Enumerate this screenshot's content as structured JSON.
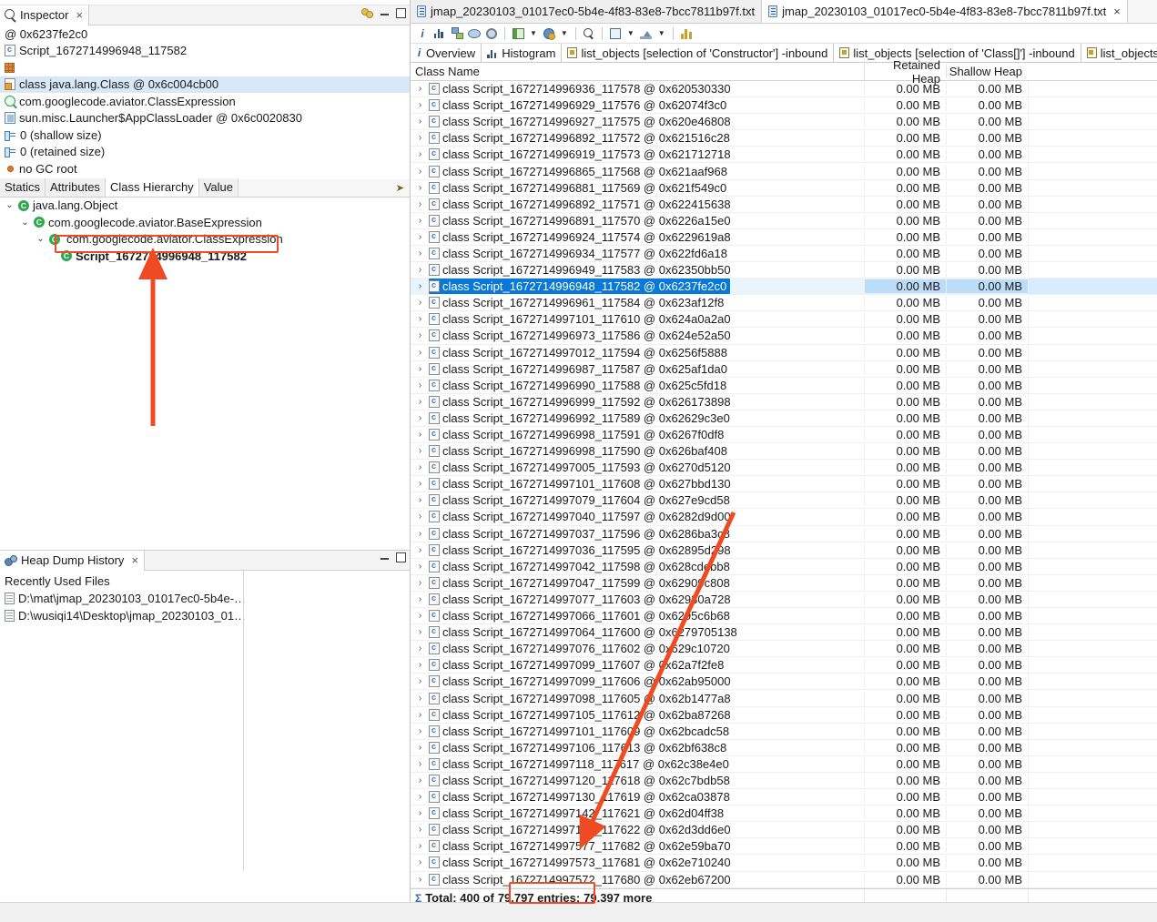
{
  "window": {
    "accent_color": "#0a78d7",
    "annotation_color": "#f04a22"
  },
  "inspector": {
    "tab_label": "Inspector",
    "tab_close": "×",
    "rows": [
      {
        "icon": "at-icon",
        "text": "@ 0x6237fe2c0"
      },
      {
        "icon": "class-file-icon",
        "text": "Script_1672714996948_117582"
      },
      {
        "icon": "grid-icon",
        "text": ""
      },
      {
        "icon": "java-class-icon",
        "text": "class java.lang.Class @ 0x6c004cb00",
        "highlighted": true
      },
      {
        "icon": "magnifier-icon",
        "text": "com.googlecode.aviator.ClassExpression"
      },
      {
        "icon": "classloader-icon",
        "text": "sun.misc.Launcher$AppClassLoader @ 0x6c0020830"
      },
      {
        "icon": "size-icon",
        "text": "0 (shallow size)"
      },
      {
        "icon": "size-icon",
        "text": "0 (retained size)"
      },
      {
        "icon": "gc-root-icon",
        "text": "no GC root"
      }
    ],
    "subtabs": [
      {
        "label": "Statics",
        "active": false
      },
      {
        "label": "Attributes",
        "active": false
      },
      {
        "label": "Class Hierarchy",
        "active": true
      },
      {
        "label": "Value",
        "active": false
      }
    ],
    "hierarchy": [
      {
        "indent": 0,
        "twisty": "⌄",
        "label": "java.lang.Object",
        "bold": false
      },
      {
        "indent": 1,
        "twisty": "⌄",
        "label": "com.googlecode.aviator.BaseExpression",
        "bold": false
      },
      {
        "indent": 2,
        "twisty": "⌄",
        "label": "com.googlecode.aviator.ClassExpression",
        "bold": false,
        "boxed": true
      },
      {
        "indent": 3,
        "twisty": "",
        "label": "Script_1672714996948_117582",
        "bold": true
      }
    ]
  },
  "heap_dump_history": {
    "tab_label": "Heap Dump History",
    "tab_close": "×",
    "section_label": "Recently Used Files",
    "files": [
      "D:\\mat\\jmap_20230103_01017ec0-5b4e-…",
      "D:\\wusiqi14\\Desktop\\jmap_20230103_01…"
    ]
  },
  "editor": {
    "tabs": [
      {
        "label": "jmap_20230103_01017ec0-5b4e-4f83-83e8-7bcc7811b97f.txt",
        "active": false,
        "closable": false
      },
      {
        "label": "jmap_20230103_01017ec0-5b4e-4f83-83e8-7bcc7811b97f.txt",
        "active": true,
        "closable": true
      }
    ],
    "tab_close": "×",
    "toolbar": [
      {
        "name": "info-icon"
      },
      {
        "name": "histogram-icon"
      },
      {
        "name": "dominator-tree-icon"
      },
      {
        "name": "inspect-icon"
      },
      {
        "name": "gear-icon"
      },
      {
        "name": "separator"
      },
      {
        "name": "group-by-icon"
      },
      {
        "name": "caret-down-icon"
      },
      {
        "name": "calculate-icon"
      },
      {
        "name": "caret-down-icon"
      },
      {
        "name": "separator"
      },
      {
        "name": "search-icon"
      },
      {
        "name": "separator"
      },
      {
        "name": "table-icon"
      },
      {
        "name": "caret-down-icon"
      },
      {
        "name": "export-icon"
      },
      {
        "name": "caret-down-icon"
      },
      {
        "name": "separator"
      },
      {
        "name": "chart-icon"
      }
    ],
    "result_tabs": [
      {
        "icon": "info-icon",
        "label": "Overview"
      },
      {
        "icon": "histogram-icon",
        "label": "Histogram"
      },
      {
        "icon": "query-icon",
        "label": "list_objects  [selection of 'Constructor'] -inbound"
      },
      {
        "icon": "query-icon",
        "label": "list_objects  [selection of 'Class[]'] -inbound"
      },
      {
        "icon": "query-icon",
        "label": "list_objects  [se"
      }
    ]
  },
  "table": {
    "columns": [
      "Class Name",
      "Retained Heap",
      "Shallow Heap"
    ],
    "twisty": "›",
    "rows": [
      {
        "name": "class Script_1672714996936_117578 @ 0x620530330",
        "retained": "0.00 MB",
        "shallow": "0.00 MB"
      },
      {
        "name": "class Script_1672714996929_117576 @ 0x62074f3c0",
        "retained": "0.00 MB",
        "shallow": "0.00 MB"
      },
      {
        "name": "class Script_1672714996927_117575 @ 0x620e46808",
        "retained": "0.00 MB",
        "shallow": "0.00 MB"
      },
      {
        "name": "class Script_1672714996892_117572 @ 0x621516c28",
        "retained": "0.00 MB",
        "shallow": "0.00 MB"
      },
      {
        "name": "class Script_1672714996919_117573 @ 0x621712718",
        "retained": "0.00 MB",
        "shallow": "0.00 MB"
      },
      {
        "name": "class Script_1672714996865_117568 @ 0x621aaf968",
        "retained": "0.00 MB",
        "shallow": "0.00 MB"
      },
      {
        "name": "class Script_1672714996881_117569 @ 0x621f549c0",
        "retained": "0.00 MB",
        "shallow": "0.00 MB"
      },
      {
        "name": "class Script_1672714996892_117571 @ 0x622415638",
        "retained": "0.00 MB",
        "shallow": "0.00 MB"
      },
      {
        "name": "class Script_1672714996891_117570 @ 0x6226a15e0",
        "retained": "0.00 MB",
        "shallow": "0.00 MB"
      },
      {
        "name": "class Script_1672714996924_117574 @ 0x6229619a8",
        "retained": "0.00 MB",
        "shallow": "0.00 MB"
      },
      {
        "name": "class Script_1672714996934_117577 @ 0x622fd6a18",
        "retained": "0.00 MB",
        "shallow": "0.00 MB"
      },
      {
        "name": "class Script_1672714996949_117583 @ 0x62350bb50",
        "retained": "0.00 MB",
        "shallow": "0.00 MB"
      },
      {
        "name": "class Script_1672714996948_117582 @ 0x6237fe2c0",
        "retained": "0.00 MB",
        "shallow": "0.00 MB",
        "selected": true
      },
      {
        "name": "class Script_1672714996961_117584 @ 0x623af12f8",
        "retained": "0.00 MB",
        "shallow": "0.00 MB"
      },
      {
        "name": "class Script_1672714997101_117610 @ 0x624a0a2a0",
        "retained": "0.00 MB",
        "shallow": "0.00 MB"
      },
      {
        "name": "class Script_1672714996973_117586 @ 0x624e52a50",
        "retained": "0.00 MB",
        "shallow": "0.00 MB"
      },
      {
        "name": "class Script_1672714997012_117594 @ 0x6256f5888",
        "retained": "0.00 MB",
        "shallow": "0.00 MB"
      },
      {
        "name": "class Script_1672714996987_117587 @ 0x625af1da0",
        "retained": "0.00 MB",
        "shallow": "0.00 MB"
      },
      {
        "name": "class Script_1672714996990_117588 @ 0x625c5fd18",
        "retained": "0.00 MB",
        "shallow": "0.00 MB"
      },
      {
        "name": "class Script_1672714996999_117592 @ 0x626173898",
        "retained": "0.00 MB",
        "shallow": "0.00 MB"
      },
      {
        "name": "class Script_1672714996992_117589 @ 0x62629c3e0",
        "retained": "0.00 MB",
        "shallow": "0.00 MB"
      },
      {
        "name": "class Script_1672714996998_117591 @ 0x6267f0df8",
        "retained": "0.00 MB",
        "shallow": "0.00 MB"
      },
      {
        "name": "class Script_1672714996998_117590 @ 0x626baf408",
        "retained": "0.00 MB",
        "shallow": "0.00 MB"
      },
      {
        "name": "class Script_1672714997005_117593 @ 0x6270d5120",
        "retained": "0.00 MB",
        "shallow": "0.00 MB"
      },
      {
        "name": "class Script_1672714997101_117608 @ 0x627bbd130",
        "retained": "0.00 MB",
        "shallow": "0.00 MB"
      },
      {
        "name": "class Script_1672714997079_117604 @ 0x627e9cd58",
        "retained": "0.00 MB",
        "shallow": "0.00 MB"
      },
      {
        "name": "class Script_1672714997040_117597 @ 0x6282d9d00",
        "retained": "0.00 MB",
        "shallow": "0.00 MB"
      },
      {
        "name": "class Script_1672714997037_117596 @ 0x6286ba3c8",
        "retained": "0.00 MB",
        "shallow": "0.00 MB"
      },
      {
        "name": "class Script_1672714997036_117595 @ 0x62895d298",
        "retained": "0.00 MB",
        "shallow": "0.00 MB"
      },
      {
        "name": "class Script_1672714997042_117598 @ 0x628cdebb8",
        "retained": "0.00 MB",
        "shallow": "0.00 MB"
      },
      {
        "name": "class Script_1672714997047_117599 @ 0x62909c808",
        "retained": "0.00 MB",
        "shallow": "0.00 MB"
      },
      {
        "name": "class Script_1672714997077_117603 @ 0x62930a728",
        "retained": "0.00 MB",
        "shallow": "0.00 MB"
      },
      {
        "name": "class Script_1672714997066_117601 @ 0x6295c6b68",
        "retained": "0.00 MB",
        "shallow": "0.00 MB"
      },
      {
        "name": "class Script_1672714997064_117600 @ 0x6279705138",
        "retained": "0.00 MB",
        "shallow": "0.00 MB"
      },
      {
        "name": "class Script_1672714997076_117602 @ 0x629c10720",
        "retained": "0.00 MB",
        "shallow": "0.00 MB"
      },
      {
        "name": "class Script_1672714997099_117607 @ 0x62a7f2fe8",
        "retained": "0.00 MB",
        "shallow": "0.00 MB"
      },
      {
        "name": "class Script_1672714997099_117606 @ 0x62ab95000",
        "retained": "0.00 MB",
        "shallow": "0.00 MB"
      },
      {
        "name": "class Script_1672714997098_117605 @ 0x62b1477a8",
        "retained": "0.00 MB",
        "shallow": "0.00 MB"
      },
      {
        "name": "class Script_1672714997105_117612 @ 0x62ba87268",
        "retained": "0.00 MB",
        "shallow": "0.00 MB"
      },
      {
        "name": "class Script_1672714997101_117609 @ 0x62bcadc58",
        "retained": "0.00 MB",
        "shallow": "0.00 MB"
      },
      {
        "name": "class Script_1672714997106_117613 @ 0x62bf638c8",
        "retained": "0.00 MB",
        "shallow": "0.00 MB"
      },
      {
        "name": "class Script_1672714997118_117617 @ 0x62c38e4e0",
        "retained": "0.00 MB",
        "shallow": "0.00 MB"
      },
      {
        "name": "class Script_1672714997120_117618 @ 0x62c7bdb58",
        "retained": "0.00 MB",
        "shallow": "0.00 MB"
      },
      {
        "name": "class Script_1672714997130_117619 @ 0x62ca03878",
        "retained": "0.00 MB",
        "shallow": "0.00 MB"
      },
      {
        "name": "class Script_1672714997142_117621 @ 0x62d04ff38",
        "retained": "0.00 MB",
        "shallow": "0.00 MB"
      },
      {
        "name": "class Script_1672714997143_117622 @ 0x62d3dd6e0",
        "retained": "0.00 MB",
        "shallow": "0.00 MB"
      },
      {
        "name": "class Script_1672714997577_117682 @ 0x62e59ba70",
        "retained": "0.00 MB",
        "shallow": "0.00 MB"
      },
      {
        "name": "class Script_1672714997573_117681 @ 0x62e710240",
        "retained": "0.00 MB",
        "shallow": "0.00 MB"
      },
      {
        "name": "class Script_1672714997572_117680 @ 0x62eb67200",
        "retained": "0.00 MB",
        "shallow": "0.00 MB"
      }
    ],
    "total_prefix": "Total: 400 of ",
    "total_boxed": "79,797 entries;",
    "total_suffix": " 79,397 more"
  }
}
